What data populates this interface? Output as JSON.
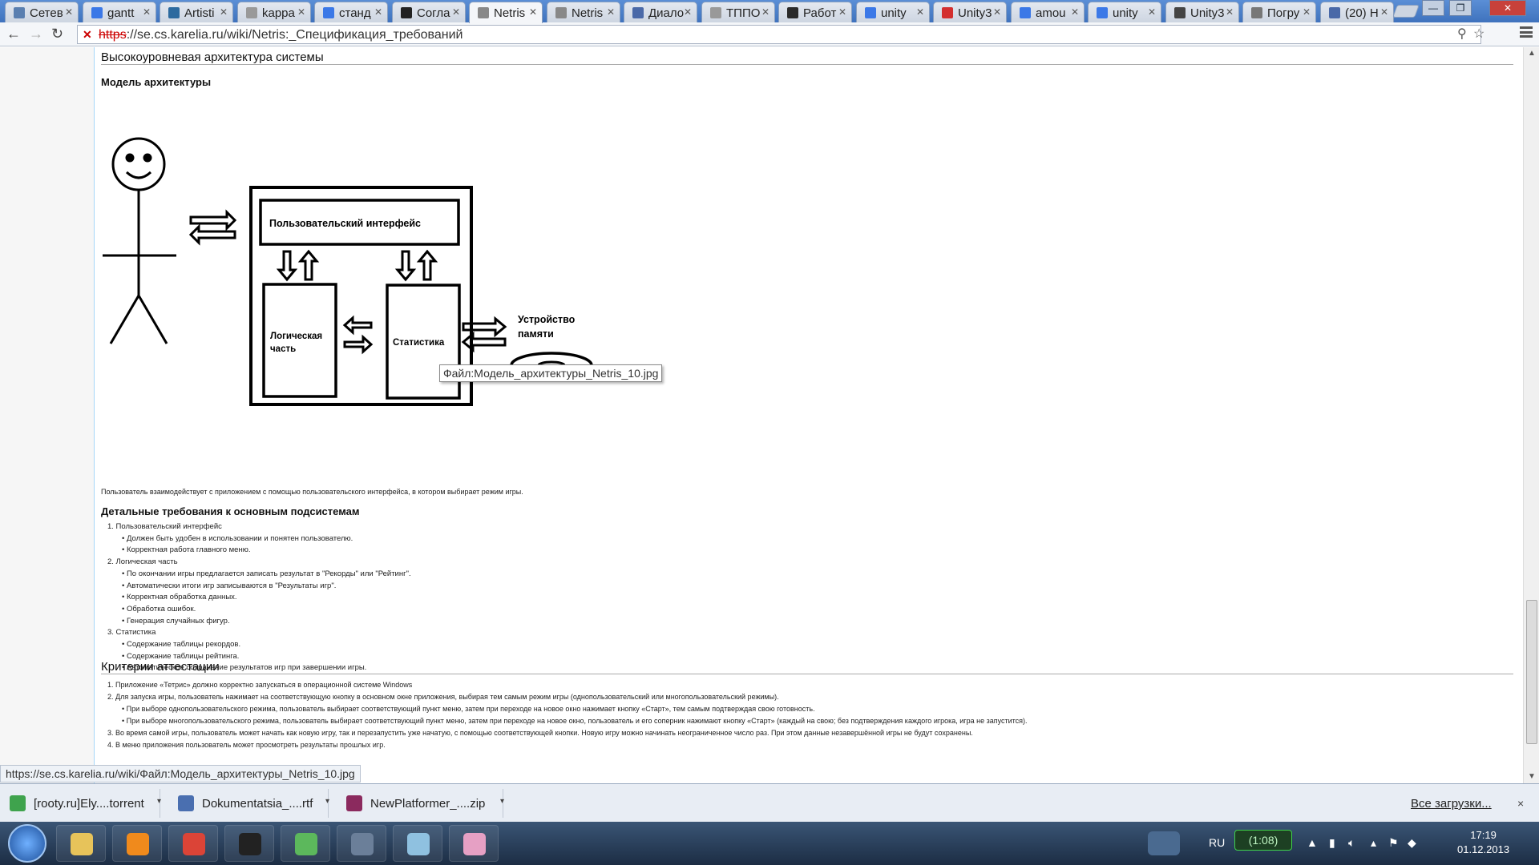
{
  "browser": {
    "tabs": [
      {
        "label": "Сетев",
        "color": "#5a7fb0"
      },
      {
        "label": "gantt",
        "color": "#3b78e7"
      },
      {
        "label": "Artisti",
        "color": "#2d6a9f"
      },
      {
        "label": "kappa",
        "color": "#999999"
      },
      {
        "label": "станд",
        "color": "#3b78e7"
      },
      {
        "label": "Согла",
        "color": "#222222"
      },
      {
        "label": "Netris",
        "color": "#888888"
      },
      {
        "label": "Netris",
        "color": "#888888"
      },
      {
        "label": "Диало",
        "color": "#4a69a8"
      },
      {
        "label": "ТППО",
        "color": "#999999"
      },
      {
        "label": "Работ",
        "color": "#2a2a2a"
      },
      {
        "label": "unity",
        "color": "#3b78e7"
      },
      {
        "label": "Unity3",
        "color": "#d32f2f"
      },
      {
        "label": "amou",
        "color": "#3b78e7"
      },
      {
        "label": "unity",
        "color": "#3b78e7"
      },
      {
        "label": "Unity3",
        "color": "#444444"
      },
      {
        "label": "Погру",
        "color": "#777777"
      },
      {
        "label": "(20) Н",
        "color": "#4a69a8"
      }
    ],
    "active_tab_index": 6,
    "url_scheme": "https",
    "url_rest": "://se.cs.karelia.ru/wiki/Netris:_Спецификация_требований",
    "window_controls": {
      "minimize": "—",
      "restore": "❐",
      "close": "✕"
    },
    "icons": [
      "back-icon",
      "forward-icon",
      "reload-icon",
      "search-icon",
      "star-icon",
      "menu-icon"
    ]
  },
  "page": {
    "section_title": "Высокоуровневая архитектура системы",
    "architecture_title": "Модель архитектуры",
    "diagram": {
      "ui_box": "Пользовательский  интерфейс",
      "logic_box_line1": "Логическая",
      "logic_box_line2": "часть",
      "stats_box": "Статистика",
      "storage_line1": "Устройство",
      "storage_line2": "памяти"
    },
    "tooltip": "Файл:Модель_архитектуры_Netris_10.jpg",
    "intro_text": "Пользователь взаимодействует с приложением с помощью пользовательского интерфейса, в котором выбирает режим игры.",
    "detailed_title": "Детальные требования к основным подсистемам",
    "requirements": [
      {
        "level": 1,
        "text": "1.  Пользовательский интерфейс"
      },
      {
        "level": 2,
        "text": "Должен быть удобен в использовании и понятен пользователю."
      },
      {
        "level": 2,
        "text": "Корректная работа главного меню."
      },
      {
        "level": 1,
        "text": "2.  Логическая часть"
      },
      {
        "level": 2,
        "text": "По окончании игры предлагается записать результат в \"Рекорды\" или \"Рейтинг\"."
      },
      {
        "level": 2,
        "text": "Автоматически итоги игр записываются в \"Результаты игр\"."
      },
      {
        "level": 2,
        "text": "Корректная обработка данных."
      },
      {
        "level": 2,
        "text": "Обработка ошибок."
      },
      {
        "level": 2,
        "text": "Генерация случайных фигур."
      },
      {
        "level": 1,
        "text": "3.  Статистика"
      },
      {
        "level": 2,
        "text": "Содержание таблицы рекордов."
      },
      {
        "level": 2,
        "text": "Содержание таблицы рейтинга."
      },
      {
        "level": 2,
        "text": "Автоматическое сохранение результатов игр при завершении игры."
      }
    ],
    "criteria_title": "Критерии аттестации",
    "criteria": [
      {
        "level": 1,
        "text": "1.  Приложение «Тетрис» должно корректно запускаться в операционной системе Windows"
      },
      {
        "level": 1,
        "text": "2.  Для запуска игры, пользователь нажимает на соответствующую кнопку в основном окне приложения, выбирая тем самым режим игры (однопользовательский или многопользовательский режимы)."
      },
      {
        "level": 2,
        "text": "При выборе однопользовательского режима, пользователь выбирает соответствующий пункт меню, затем при переходе на новое окно нажимает кнопку «Старт», тем самым подтверждая свою готовность."
      },
      {
        "level": 2,
        "text": "При выборе многопользовательского режима, пользователь выбирает соответствующий пункт меню, затем при переходе на новое окно, пользователь и его соперник нажимают кнопку «Старт» (каждый на свою; без подтверждения каждого игрока, игра не запустится)."
      },
      {
        "level": 1,
        "text": "3.  Во время самой игры, пользователь может начать как новую игру, так и перезапустить уже начатую, с помощью соответствующей кнопки. Новую игру можно начинать неограниченное число раз. При этом данные незавершённой игры не будут сохранены."
      },
      {
        "level": 1,
        "text": "4.  В меню приложения пользователь может просмотреть результаты прошлых игр."
      }
    ]
  },
  "status_bubble": "https://se.cs.karelia.ru/wiki/Файл:Модель_архитектуры_Netris_10.jpg",
  "downloads": {
    "items": [
      {
        "label": "[rooty.ru]Ely....torrent",
        "color": "#3fa34d"
      },
      {
        "label": "Dokumentatsia_....rtf",
        "color": "#4a6fb0"
      },
      {
        "label": "NewPlatformer_....zip",
        "color": "#8b2a5e"
      }
    ],
    "all_label": "Все загрузки...",
    "close": "×"
  },
  "taskbar": {
    "apps": [
      {
        "name": "explorer",
        "color": "#e7c35a"
      },
      {
        "name": "media-player",
        "color": "#f08a1c"
      },
      {
        "name": "chrome",
        "color": "#db4437"
      },
      {
        "name": "unity",
        "color": "#222222"
      },
      {
        "name": "utorrent",
        "color": "#5cb85c"
      },
      {
        "name": "network-tool",
        "color": "#6b7f99"
      },
      {
        "name": "notepad",
        "color": "#8fc1e0"
      },
      {
        "name": "paint",
        "color": "#e6a0c4"
      }
    ],
    "lang": "RU",
    "battery_time": "(1:08)",
    "time": "17:19",
    "date": "01.12.2013"
  }
}
